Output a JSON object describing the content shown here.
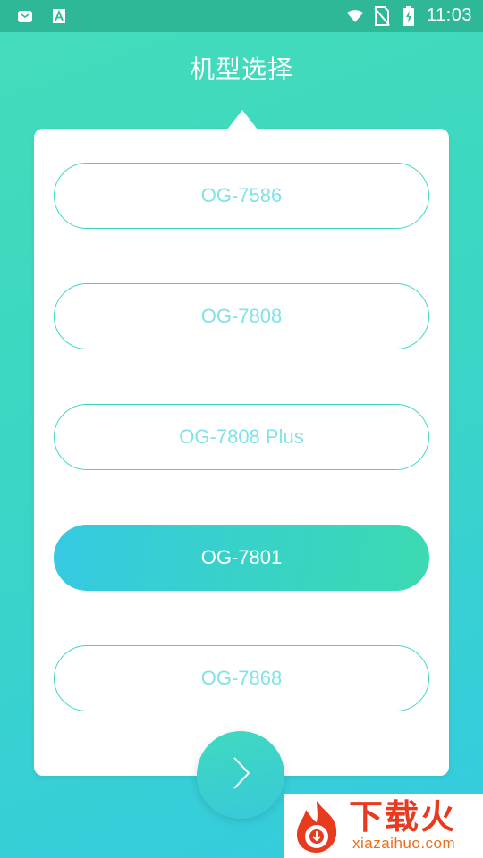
{
  "status_bar": {
    "time": "11:03",
    "left_icons": [
      "notification-app-icon",
      "text-a-icon"
    ],
    "right_icons": [
      "wifi-icon",
      "no-sim-icon",
      "battery-charging-icon"
    ]
  },
  "header": {
    "title": "机型选择"
  },
  "models": [
    {
      "label": "OG-7586",
      "selected": false
    },
    {
      "label": "OG-7808",
      "selected": false
    },
    {
      "label": "OG-7808 Plus",
      "selected": false
    },
    {
      "label": "OG-7801",
      "selected": true
    },
    {
      "label": "OG-7868",
      "selected": false
    }
  ],
  "next_button": {
    "icon": "chevron-right-icon"
  },
  "watermark": {
    "text": "下载火",
    "url": "xiazaihuo.com"
  },
  "colors": {
    "accent_teal": "#3fd6c5",
    "accent_blue": "#36c9e2",
    "unselected_text": "#7fe3e8",
    "status_bar": "#2fb897",
    "watermark_red": "#e83a1f"
  }
}
